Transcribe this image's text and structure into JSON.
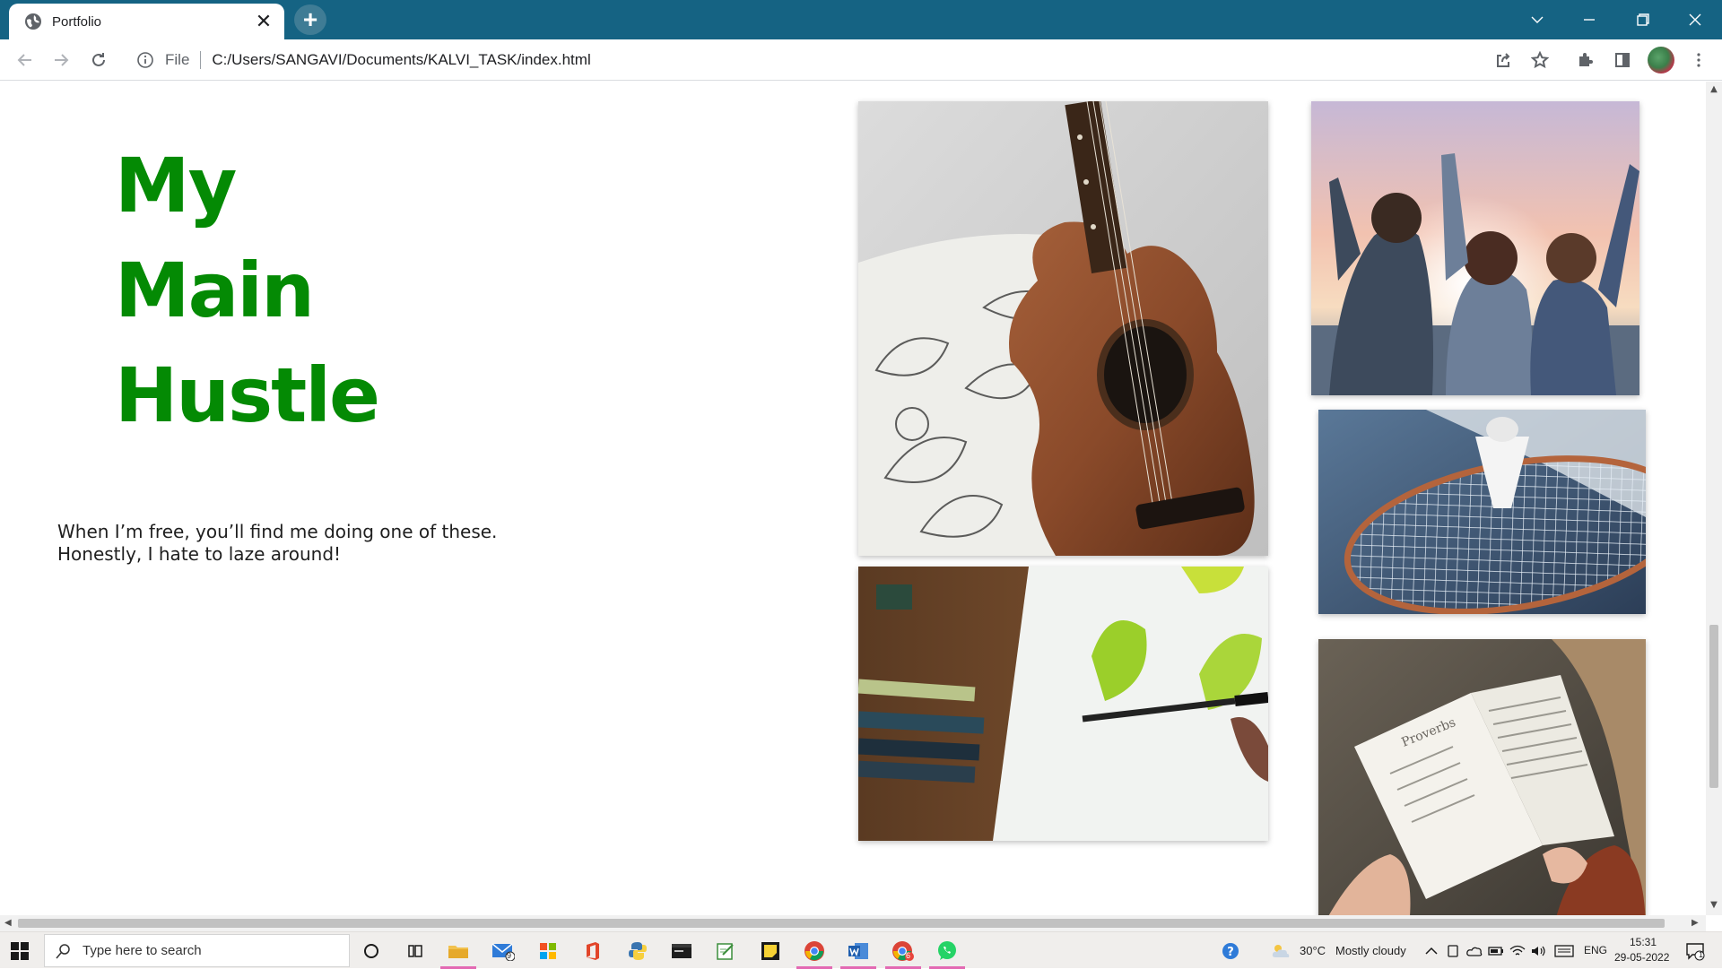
{
  "browser": {
    "tab_title": "Portfolio",
    "tab_close_glyph": "✕",
    "new_tab_glyph": "+",
    "address_scheme_chip": "File",
    "address_url": "C:/Users/SANGAVI/Documents/KALVI_TASK/index.html",
    "chrome_color": "#156383"
  },
  "page": {
    "heading_lines": [
      "My",
      "Main",
      "Hustle"
    ],
    "heading_color": "#048a04",
    "tagline_lines": [
      "When I’m free, you’ll find me doing one of these.",
      "Honestly, I hate to laze around!"
    ],
    "photos": [
      {
        "name": "guitar-photo",
        "subject": "acoustic guitar on patterned pillow"
      },
      {
        "name": "friends-sunset-photo",
        "subject": "friends cheering at sunset"
      },
      {
        "name": "badminton-photo",
        "subject": "badminton racket with shuttlecock"
      },
      {
        "name": "painting-photo",
        "subject": "painting green leaves with brush and pencils"
      },
      {
        "name": "reading-photo",
        "subject": "person reading an open book"
      }
    ],
    "book_page_text": "Proverbs"
  },
  "taskbar": {
    "search_placeholder": "Type here to search",
    "mail_badge": "9",
    "chrome2_badge": "6",
    "weather_temp": "30°C",
    "weather_text": "Mostly cloudy",
    "language": "ENG",
    "time": "15:31",
    "date": "29-05-2022",
    "notification_badge": "1"
  }
}
